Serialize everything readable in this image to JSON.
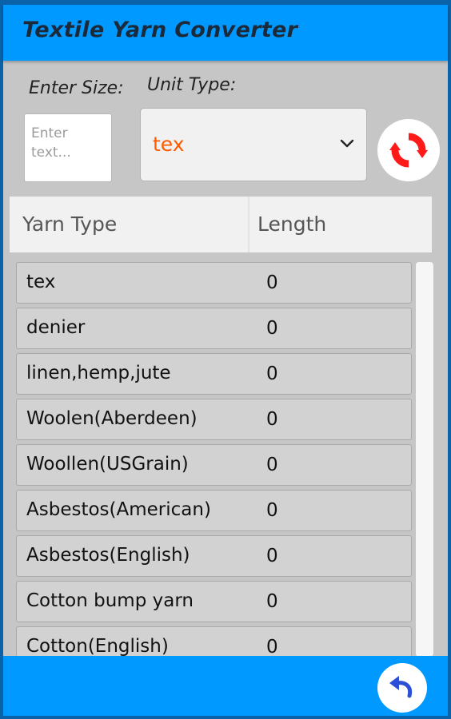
{
  "app": {
    "title": "Textile Yarn Converter",
    "colors": {
      "primary": "#0099ff",
      "accent": "#ff5a00",
      "refresh_icon": "#ff1a1a",
      "back_icon": "#2b4fd6"
    }
  },
  "form": {
    "size_label": "Enter Size:",
    "size_placeholder": "Enter text...",
    "unit_label": "Unit Type:",
    "unit_selected": "tex",
    "refresh_icon": "refresh-icon"
  },
  "table": {
    "headers": {
      "type": "Yarn Type",
      "length": "Length"
    },
    "rows": [
      {
        "name": "tex",
        "value": "0"
      },
      {
        "name": "denier",
        "value": "0"
      },
      {
        "name": "linen,hemp,jute",
        "value": "0"
      },
      {
        "name": "Woolen(Aberdeen)",
        "value": "0"
      },
      {
        "name": "Woollen(USGrain)",
        "value": "0"
      },
      {
        "name": "Asbestos(American)",
        "value": "0"
      },
      {
        "name": "Asbestos(English)",
        "value": "0"
      },
      {
        "name": "Cotton bump yarn",
        "value": "0"
      },
      {
        "name": "Cotton(English)",
        "value": "0"
      }
    ]
  },
  "footer": {
    "back_icon": "back-arrow-icon"
  }
}
